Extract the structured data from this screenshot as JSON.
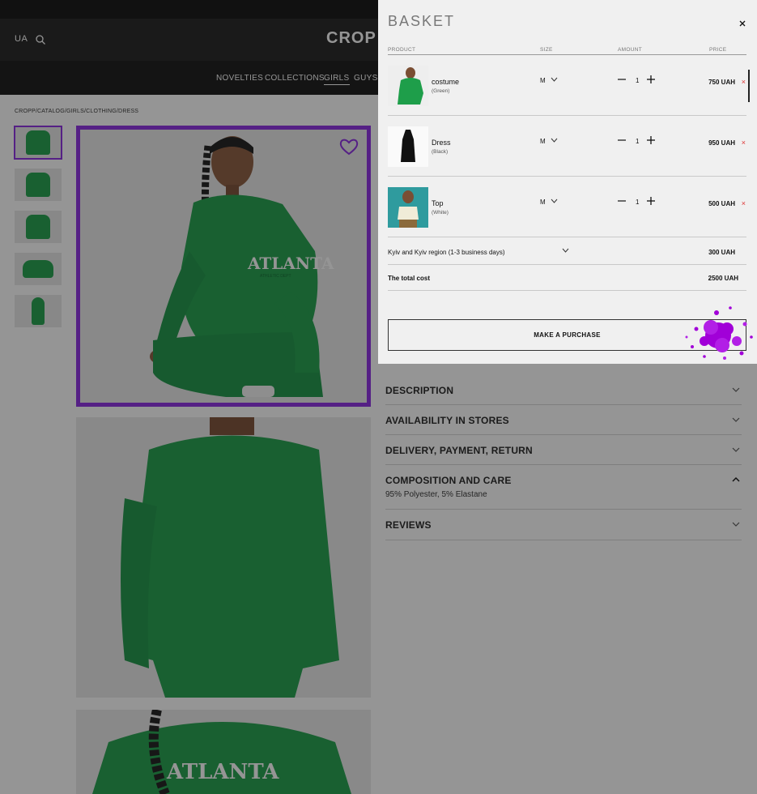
{
  "header": {
    "lang": "UA",
    "logo": "CROP"
  },
  "nav": [
    "NOVELTIES",
    "COLLECTIONS",
    "GIRLS",
    "GUYS"
  ],
  "breadcrumb": "CROPP/CATALOG/GIRLS/CLOTHING/DRESS",
  "accordion": [
    {
      "title": "DESCRIPTION"
    },
    {
      "title": "AVAILABILITY IN STORES"
    },
    {
      "title": "DELIVERY, PAYMENT, RETURN"
    },
    {
      "title": "COMPOSITION AND CARE",
      "detail": "95% Polyester, 5% Elastane"
    },
    {
      "title": "REVIEWS"
    }
  ],
  "photo_text": {
    "print_main": "ATLANTA",
    "print_sub": "ATHLETIC DEPT"
  },
  "basket": {
    "title": "BASKET",
    "headers": {
      "product": "PRODUCT",
      "size": "SIZE",
      "amount": "AMOUNT",
      "price": "PRICE"
    },
    "items": [
      {
        "name": "costume",
        "color": "(Green)",
        "size": "M",
        "qty": "1",
        "price": "750 UAH",
        "remove": "×"
      },
      {
        "name": "Dress",
        "color": "(Black)",
        "size": "M",
        "qty": "1",
        "price": "950 UAH",
        "remove": "×"
      },
      {
        "name": "Top",
        "color": "(White)",
        "size": "M",
        "qty": "1",
        "price": "500 UAH",
        "remove": "×"
      }
    ],
    "delivery_option": "Kyiv and Kyiv region (1-3 business days)",
    "delivery_price": "300 UAH",
    "total_label": "The total cost",
    "total_value": "2500 UAH",
    "purchase_label": "MAKE A PURCHASE"
  },
  "colors": {
    "accent": "#8a2be2",
    "product_green": "#1e9e4a",
    "remove": "#dd3333"
  },
  "icons": [
    "search-icon",
    "heart-icon",
    "close-icon",
    "chevron-down-icon",
    "chevron-up-icon",
    "minus-icon",
    "plus-icon"
  ]
}
